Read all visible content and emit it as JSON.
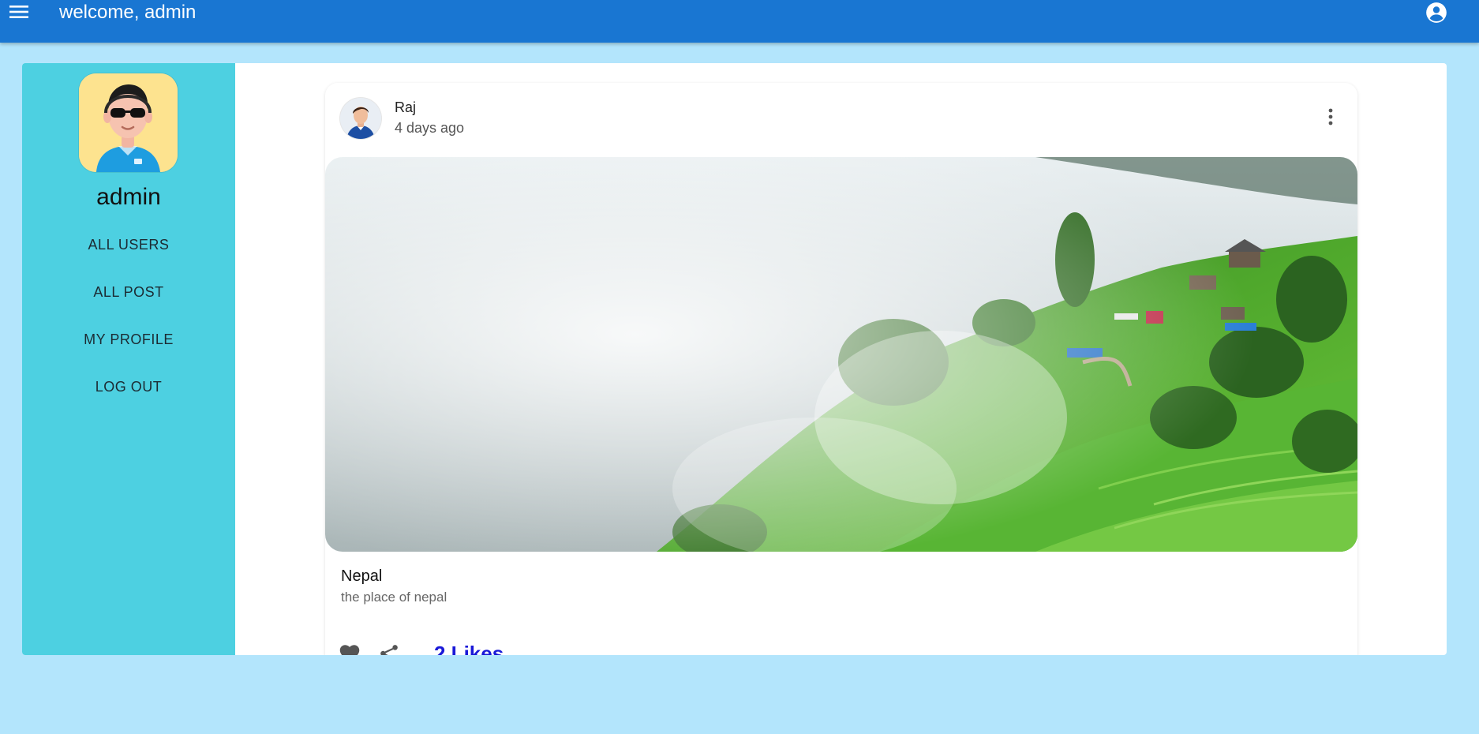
{
  "appbar": {
    "title": "welcome, admin",
    "color": "#1976d2"
  },
  "icons": {
    "menu": "menu-icon",
    "account": "account-circle-icon",
    "more": "more-vert-icon",
    "like": "heart-icon",
    "share": "share-icon"
  },
  "sidebar": {
    "name": "admin",
    "background": "#4dd0e1",
    "items": [
      {
        "label": "ALL USERS"
      },
      {
        "label": "ALL POST"
      },
      {
        "label": "MY PROFILE"
      },
      {
        "label": "LOG OUT"
      }
    ]
  },
  "post": {
    "author": "Raj",
    "time": "4 days ago",
    "title": "Nepal",
    "description": "the place of nepal",
    "likes": "2 Likes"
  }
}
